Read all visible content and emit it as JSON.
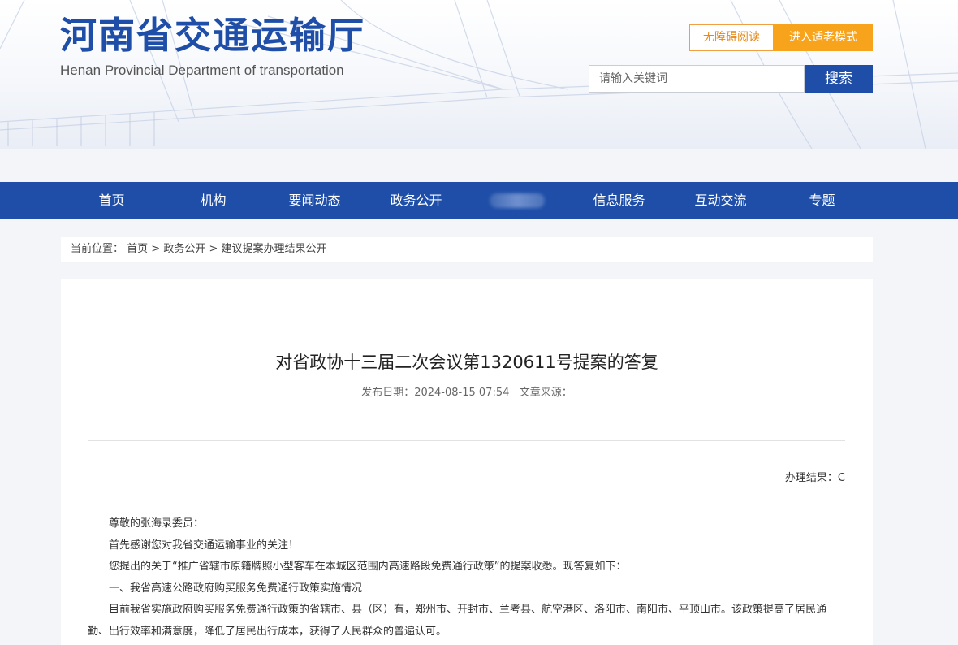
{
  "header": {
    "title_cn": "河南省交通运输厅",
    "title_en": "Henan Provincial Department of transportation",
    "accessibility_label": "无障碍阅读",
    "elder_mode_label": "进入适老模式",
    "search_placeholder": "请输入关键词",
    "search_button": "搜索"
  },
  "nav": {
    "items": [
      "首页",
      "机构",
      "要闻动态",
      "政务公开",
      "",
      "信息服务",
      "互动交流",
      "专题"
    ]
  },
  "breadcrumb": {
    "prefix": "当前位置：",
    "items": [
      "首页",
      "政务公开",
      "建议提案办理结果公开"
    ],
    "separator": " > "
  },
  "article": {
    "title": "对省政协十三届二次会议第1320611号提案的答复",
    "publish_label": "发布日期：",
    "publish_date": "2024-08-15 07:54",
    "source_label": "文章来源：",
    "result_label": "办理结果：",
    "result_value": "C",
    "paragraphs": [
      "尊敬的张海录委员：",
      "首先感谢您对我省交通运输事业的关注！",
      "您提出的关于“推广省辖市原籍牌照小型客车在本城区范围内高速路段免费通行政策”的提案收悉。现答复如下：",
      "一、我省高速公路政府购买服务免费通行政策实施情况",
      "目前我省实施政府购买服务免费通行政策的省辖市、县（区）有，郑州市、开封市、兰考县、航空港区、洛阳市、南阳市、平顶山市。该政策提高了居民通勤、出行效率和满意度，降低了居民出行成本，获得了人民群众的普遍认可。"
    ]
  },
  "colors": {
    "brand_blue": "#1e4ea8",
    "orange": "#f7a31c"
  }
}
